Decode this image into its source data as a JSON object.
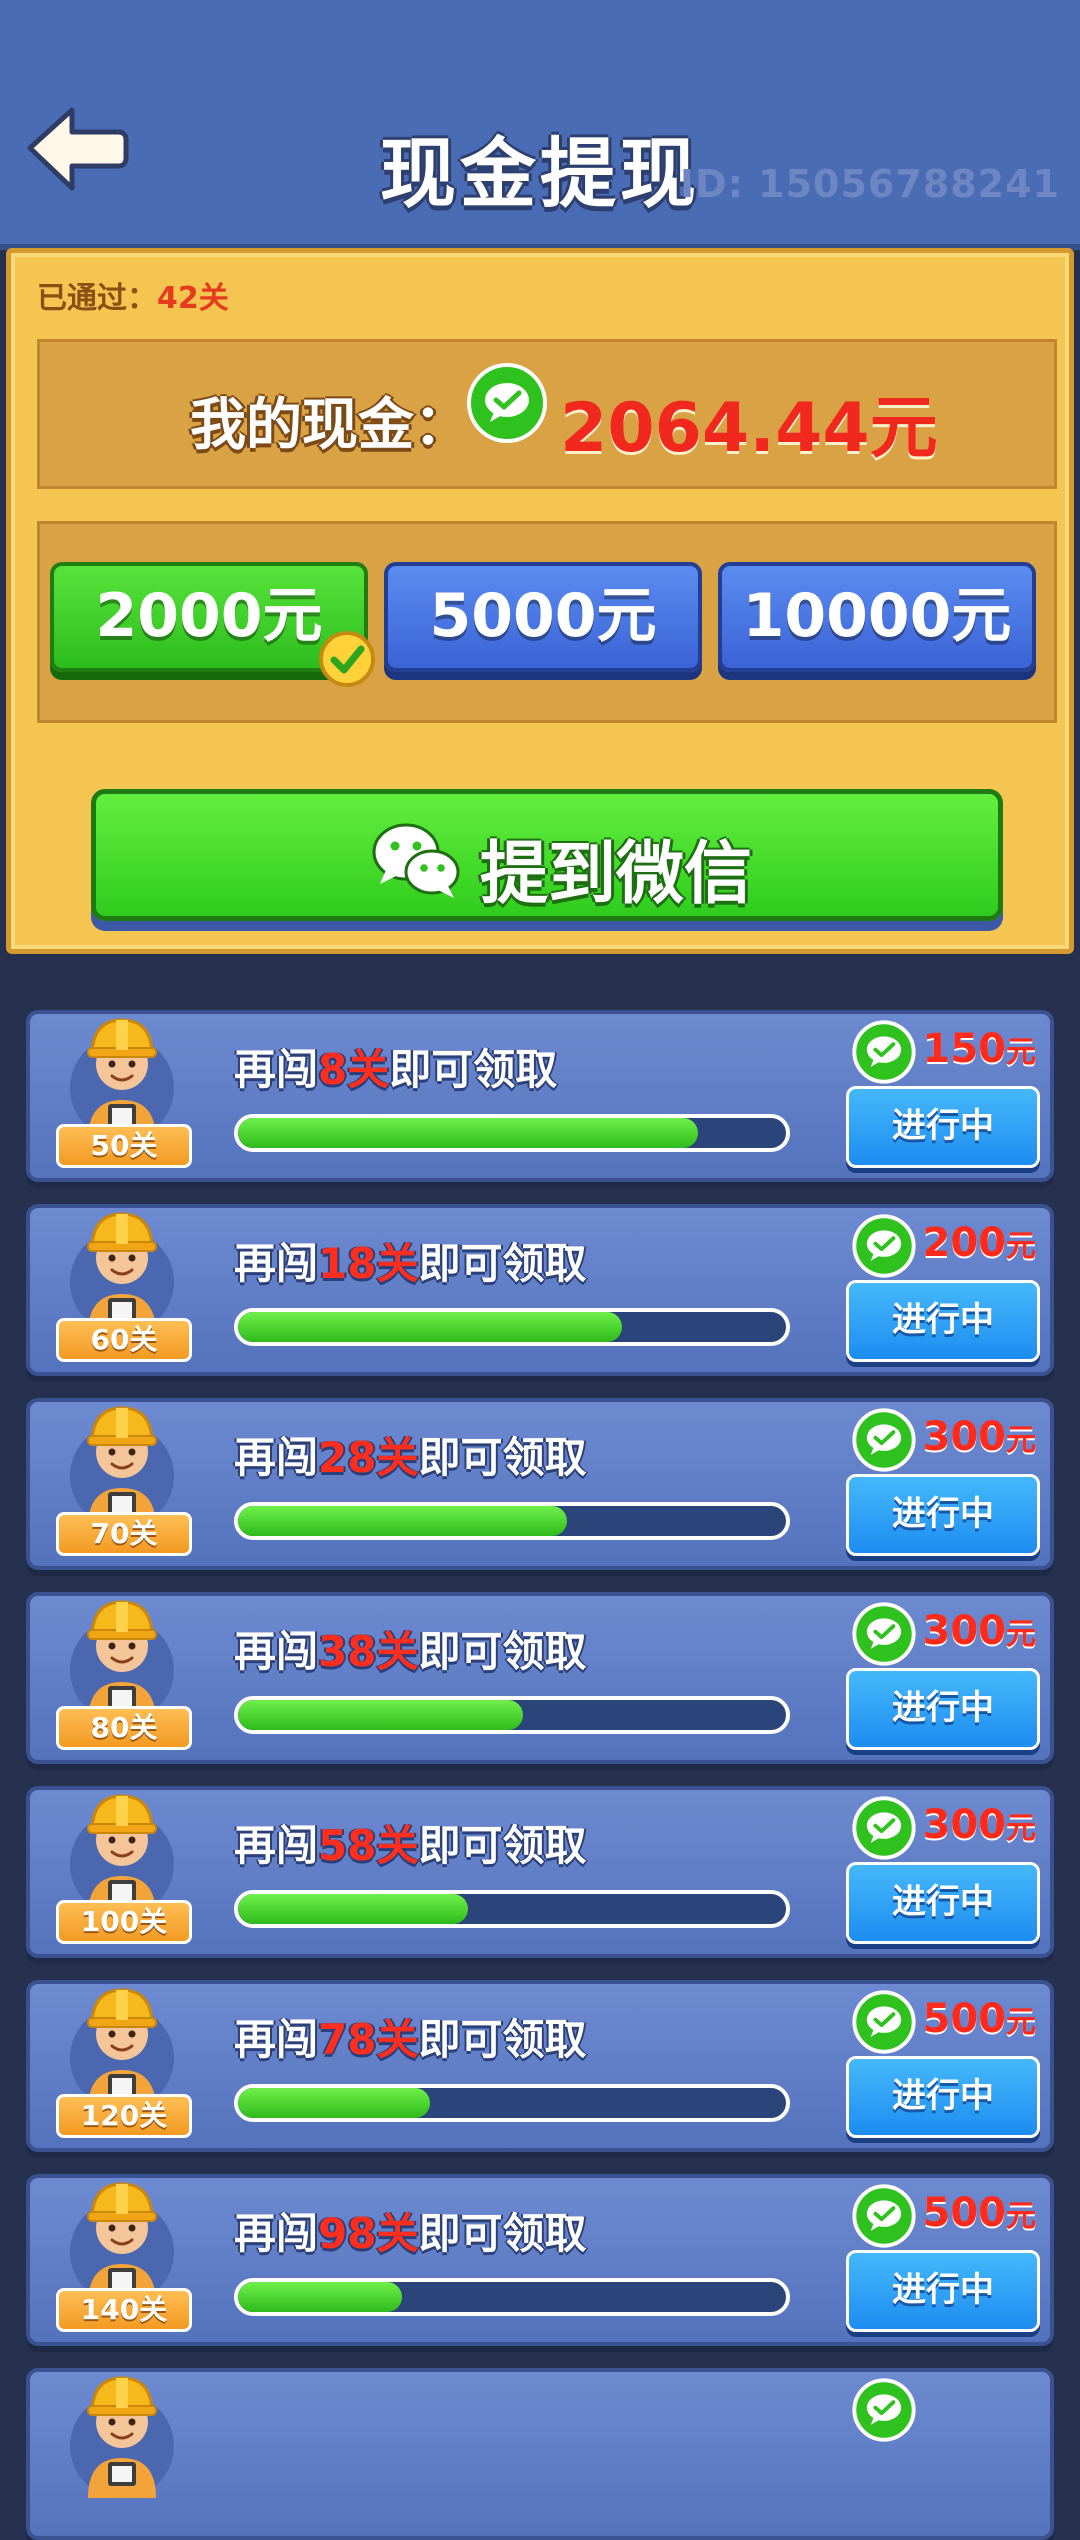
{
  "header": {
    "title": "现金提现",
    "user_id": "ID: 15056788241"
  },
  "panel": {
    "passed_label": "已通过：",
    "passed_value": "42关",
    "balance_label": "我的现金：",
    "balance_value": "2064.44元",
    "amounts": [
      {
        "label": "2000元",
        "selected": true,
        "color": "#3ed124"
      },
      {
        "label": "5000元",
        "selected": false,
        "color": "#4a78e4"
      },
      {
        "label": "10000元",
        "selected": false,
        "color": "#4a78e4"
      }
    ],
    "withdraw_label": "提到微信"
  },
  "tasks": [
    {
      "level": "50关",
      "prefix": "再闯",
      "remaining": "8关",
      "suffix": "即可领取",
      "progress": 0.84,
      "reward": "150",
      "unit": "元",
      "status": "进行中"
    },
    {
      "level": "60关",
      "prefix": "再闯",
      "remaining": "18关",
      "suffix": "即可领取",
      "progress": 0.7,
      "reward": "200",
      "unit": "元",
      "status": "进行中"
    },
    {
      "level": "70关",
      "prefix": "再闯",
      "remaining": "28关",
      "suffix": "即可领取",
      "progress": 0.6,
      "reward": "300",
      "unit": "元",
      "status": "进行中"
    },
    {
      "level": "80关",
      "prefix": "再闯",
      "remaining": "38关",
      "suffix": "即可领取",
      "progress": 0.52,
      "reward": "300",
      "unit": "元",
      "status": "进行中"
    },
    {
      "level": "100关",
      "prefix": "再闯",
      "remaining": "58关",
      "suffix": "即可领取",
      "progress": 0.42,
      "reward": "300",
      "unit": "元",
      "status": "进行中"
    },
    {
      "level": "120关",
      "prefix": "再闯",
      "remaining": "78关",
      "suffix": "即可领取",
      "progress": 0.35,
      "reward": "500",
      "unit": "元",
      "status": "进行中"
    },
    {
      "level": "140关",
      "prefix": "再闯",
      "remaining": "98关",
      "suffix": "即可领取",
      "progress": 0.3,
      "reward": "500",
      "unit": "元",
      "status": "进行中"
    }
  ],
  "colors": {
    "header_bg": "#4a6cb5",
    "panel_bg": "#f4c550",
    "highlight_red": "#f0281d",
    "progress_green": "#3fd124",
    "status_blue": "#2f9ff5"
  },
  "icons": {
    "back": "back-arrow-icon",
    "cash": "wechat-pay-icon",
    "check": "checkmark-icon",
    "wechat": "wechat-icon"
  }
}
